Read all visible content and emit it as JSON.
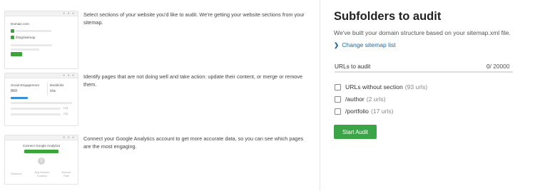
{
  "steps": [
    {
      "text": "Select sections of your website you'd like to audit. We're getting your website sections from your sitemap.",
      "mock": {
        "domain": "Domain.com",
        "path": "/blog/sitemap"
      }
    },
    {
      "text": "Identify pages that are not doing well and take action: update their content, or merge or remove them.",
      "mock": {
        "col1": "Social Engagement",
        "col1_value": "860",
        "col2": "Backlinks",
        "col2_value": "n/a",
        "na1": "n/a",
        "na2": "n/a"
      }
    },
    {
      "text": "Connect your Google Analytics account to get more accurate data, so you can see which pages are the most engaging.",
      "mock": {
        "title": "Connect Google Analytics",
        "m1": "Sessions",
        "m2": "Avg Session Duration",
        "m3": "Bounce Rate"
      }
    }
  ],
  "panel": {
    "title": "Subfolders to audit",
    "description": "We've built your domain structure based on your sitemap.xml file.",
    "change_link": "Change sitemap list",
    "urls_label": "URLs to audit",
    "urls_selected": "0",
    "urls_total": "/ 20000",
    "urls_fraction": 0,
    "subfolders": [
      {
        "name": "URLs without section",
        "count": "(93 urls)",
        "checked": false
      },
      {
        "name": "/author",
        "count": "(2 urls)",
        "checked": false
      },
      {
        "name": "/portfolio",
        "count": "(17 urls)",
        "checked": false
      }
    ],
    "start_button": "Start Audit"
  },
  "colors": {
    "accent_green": "#3aa446",
    "link_blue": "#1a6aa5",
    "bar_blue": "#3b8fd0"
  }
}
